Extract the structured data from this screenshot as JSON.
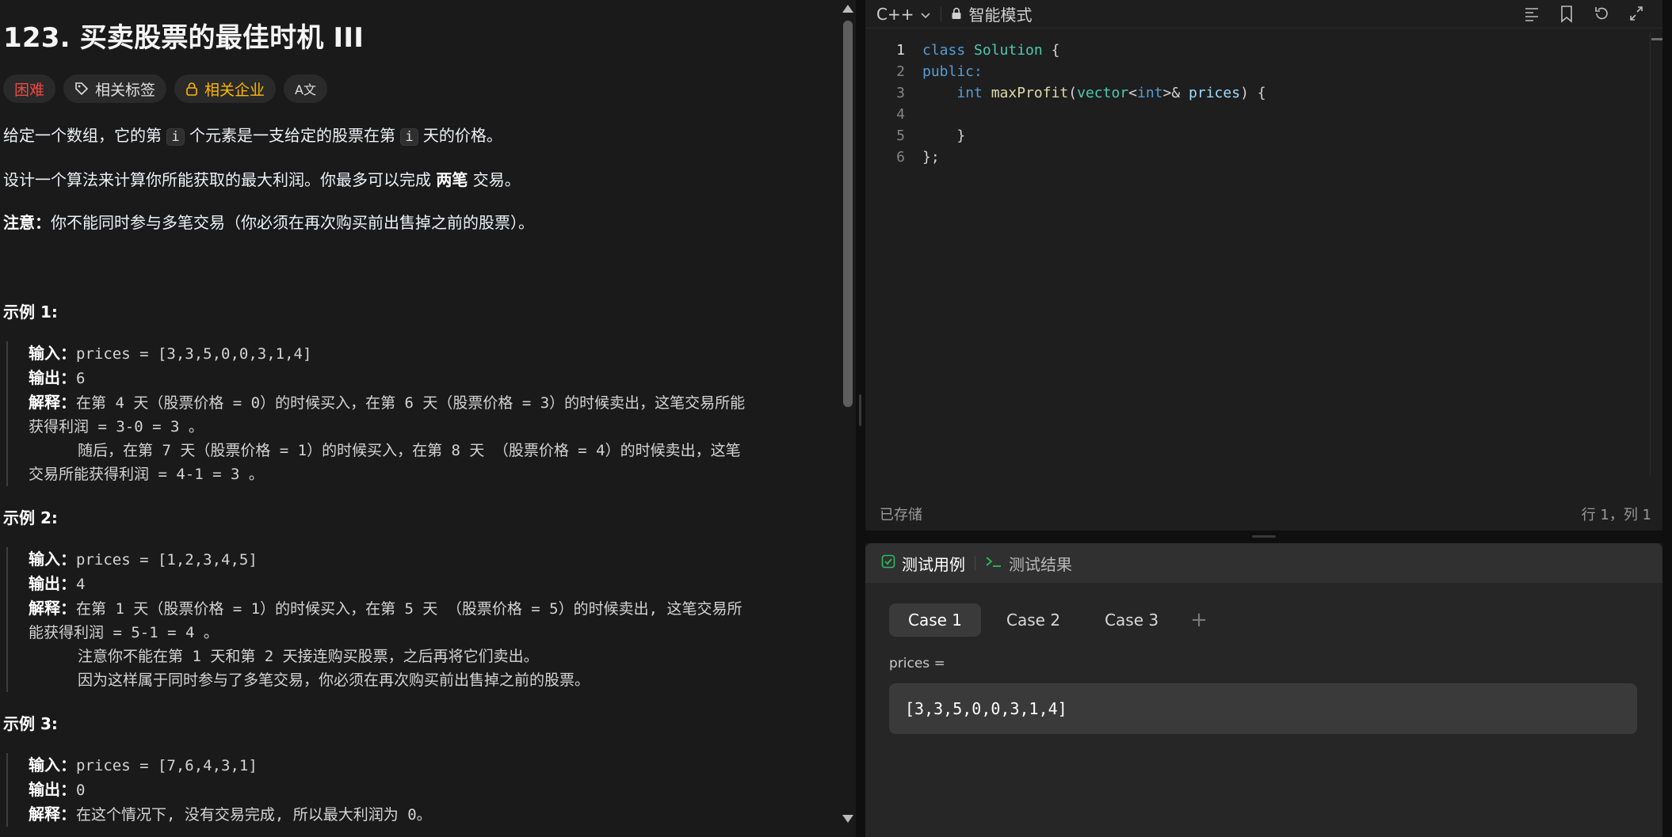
{
  "problem": {
    "title": "123. 买卖股票的最佳时机 III",
    "tags": {
      "difficulty": "困难",
      "related_tags": "相关标签",
      "related_companies": "相关企业",
      "translate_icon": "A文"
    },
    "desc": {
      "p1_a": "给定一个数组，它的第 ",
      "p1_code1": "i",
      "p1_b": " 个元素是一支给定的股票在第 ",
      "p1_code2": "i",
      "p1_c": " 天的价格。",
      "p2_a": "设计一个算法来计算你所能获取的最大利润。你最多可以完成 ",
      "p2_bold": "两笔",
      "p2_b": " 交易。",
      "p3_bold": "注意：",
      "p3_text": "你不能同时参与多笔交易（你必须在再次购买前出售掉之前的股票）。"
    },
    "examples": [
      {
        "title": "示例 1:",
        "input_label": "输入：",
        "input": "prices = [3,3,5,0,0,3,1,4]",
        "output_label": "输出：",
        "output": "6",
        "explain_label": "解释：",
        "explain_1": "在第 4 天（股票价格 = 0）的时候买入，在第 6 天（股票价格 = 3）的时候卖出，这笔交易所能",
        "explain_2": "获得利润 = 3-0 = 3 。",
        "explain_3": "随后，在第 7 天（股票价格 = 1）的时候买入，在第 8 天 （股票价格 = 4）的时候卖出，这笔",
        "explain_4": "交易所能获得利润 = 4-1 = 3 。"
      },
      {
        "title": "示例 2:",
        "input_label": "输入：",
        "input": "prices = [1,2,3,4,5]",
        "output_label": "输出：",
        "output": "4",
        "explain_label": "解释：",
        "explain_1": "在第 1 天（股票价格 = 1）的时候买入，在第 5 天 （股票价格 = 5）的时候卖出, 这笔交易所",
        "explain_2": "能获得利润 = 5-1 = 4 。",
        "explain_3": "注意你不能在第 1 天和第 2 天接连购买股票，之后再将它们卖出。",
        "explain_4": "因为这样属于同时参与了多笔交易，你必须在再次购买前出售掉之前的股票。"
      },
      {
        "title": "示例 3:",
        "input_label": "输入：",
        "input": "prices = [7,6,4,3,1]",
        "output_label": "输出：",
        "output": "0",
        "explain_label": "解释：",
        "explain_1": "在这个情况下, 没有交易完成, 所以最大利润为 0。"
      }
    ]
  },
  "editor": {
    "language": "C++",
    "mode": "智能模式",
    "line_numbers": [
      "1",
      "2",
      "3",
      "4",
      "5",
      "6"
    ],
    "status_saved": "已存储",
    "status_position": "行 1，列 1",
    "code": {
      "l1_kw": "class",
      "l1_name": "Solution",
      "l1_rest": " {",
      "l2": "public:",
      "l3_type": "int",
      "l3_fn": "maxProfit",
      "l3_a": "(",
      "l3_vec": "vector",
      "l3_lt": "<",
      "l3_int": "int",
      "l3_gt": ">&",
      "l3_param": "prices",
      "l3_end": ") {",
      "l5": "}",
      "l6": "};"
    }
  },
  "testpanel": {
    "tab_cases": "测试用例",
    "tab_results": "测试结果",
    "cases": [
      "Case 1",
      "Case 2",
      "Case 3"
    ],
    "add": "+",
    "param_label": "prices =",
    "param_value": "[3,3,5,0,0,3,1,4]"
  }
}
